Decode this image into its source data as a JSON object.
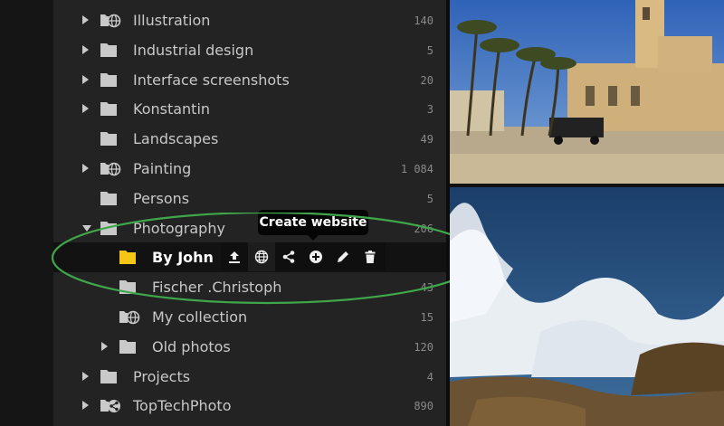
{
  "tooltip": {
    "text": "Create website"
  },
  "tree": [
    {
      "label": "Illustration",
      "count": "140",
      "icon": "folder-globe-icon",
      "expand": "collapsed"
    },
    {
      "label": "Industrial design",
      "count": "5",
      "icon": "folder-icon",
      "expand": "collapsed"
    },
    {
      "label": "Interface screenshots",
      "count": "20",
      "icon": "folder-icon",
      "expand": "collapsed"
    },
    {
      "label": "Konstantin",
      "count": "3",
      "icon": "folder-icon",
      "expand": "collapsed"
    },
    {
      "label": "Landscapes",
      "count": "49",
      "icon": "folder-icon",
      "expand": "none"
    },
    {
      "label": "Painting",
      "count": "1 084",
      "icon": "folder-globe-icon",
      "expand": "collapsed"
    },
    {
      "label": "Persons",
      "count": "5",
      "icon": "folder-icon",
      "expand": "none"
    },
    {
      "label": "Photography",
      "count": "206",
      "icon": "folder-icon",
      "expand": "expanded"
    },
    {
      "label": "By John",
      "count": "",
      "icon": "folder-icon",
      "expand": "none",
      "selected": true,
      "color": "#f5c518"
    },
    {
      "label": "Fischer .Christoph",
      "count": "43",
      "icon": "folder-icon",
      "expand": "none"
    },
    {
      "label": "My collection",
      "count": "15",
      "icon": "folder-globe-icon",
      "expand": "none"
    },
    {
      "label": "Old photos",
      "count": "120",
      "icon": "folder-icon",
      "expand": "collapsed"
    },
    {
      "label": "Projects",
      "count": "4",
      "icon": "folder-icon",
      "expand": "collapsed"
    },
    {
      "label": "TopTechPhoto",
      "count": "890",
      "icon": "folder-share-icon",
      "expand": "collapsed"
    }
  ],
  "actions": [
    {
      "name": "upload-icon"
    },
    {
      "name": "globe-icon",
      "active": true
    },
    {
      "name": "share-icon"
    },
    {
      "name": "add-circle-icon"
    },
    {
      "name": "pencil-icon"
    },
    {
      "name": "trash-icon"
    }
  ],
  "colors": {
    "folder": "#c9c9c9",
    "selected_folder": "#f5c518",
    "highlight_ellipse": "#3fa64a"
  }
}
